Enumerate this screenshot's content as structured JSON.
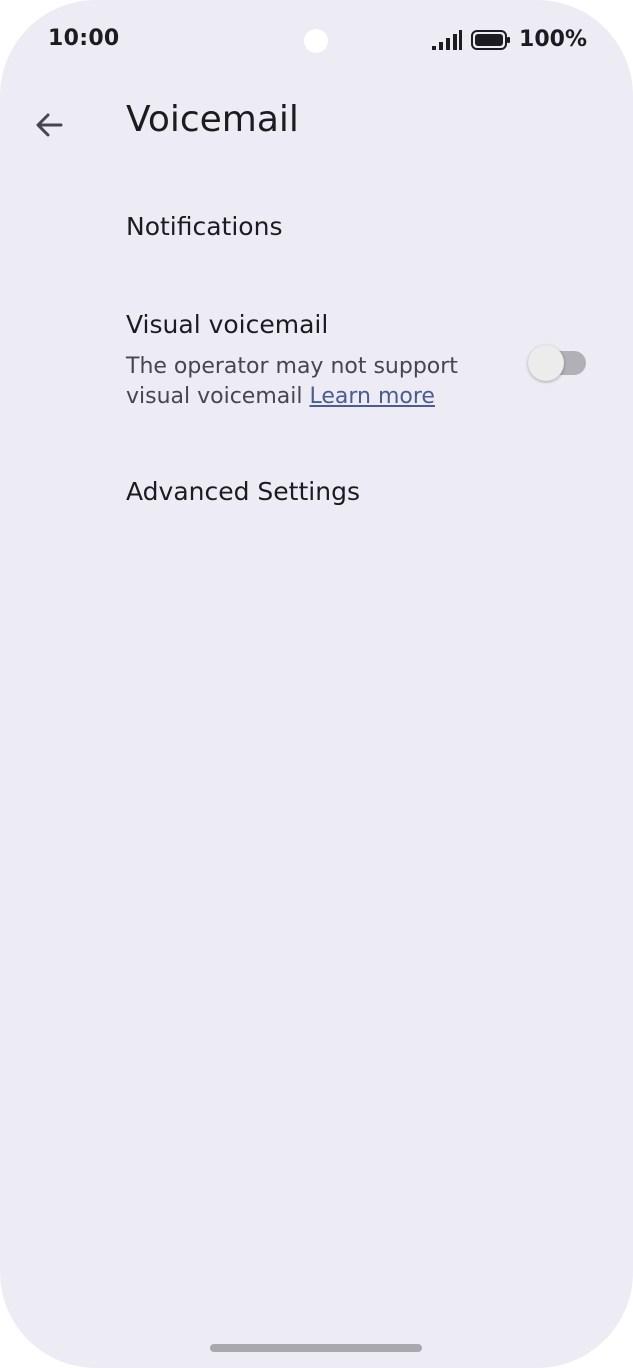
{
  "status_bar": {
    "time": "10:00",
    "battery": "100%",
    "icons": [
      "signal-icon",
      "battery-icon"
    ]
  },
  "app_bar": {
    "back_icon": "arrow-back-icon",
    "title": "Voicemail"
  },
  "settings": {
    "notifications": {
      "title": "Notifications"
    },
    "visual_voicemail": {
      "title": "Visual voicemail",
      "summary": "The operator may not support visual voicemail",
      "link": "Learn more",
      "enabled": false
    },
    "advanced": {
      "title": "Advanced Settings"
    }
  },
  "colors": {
    "background": "#edecf4",
    "link": "#4a5c92",
    "toggle_off_track": "#b0b0b7"
  }
}
